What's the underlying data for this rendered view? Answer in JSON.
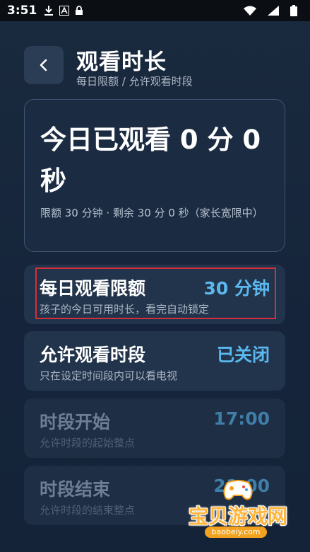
{
  "status_bar": {
    "time": "3:51"
  },
  "header": {
    "back_label": "<",
    "title": "观看时长",
    "subtitle": "每日限额 / 允许观看时段"
  },
  "summary": {
    "watched_today": "今日已观看 0 分 0 秒",
    "note": "限额 30 分钟 · 剩余 30 分 0 秒（家长宽限中）"
  },
  "settings": [
    {
      "title": "每日观看限额",
      "desc": "孩子的今日可用时长，看完自动锁定",
      "value": "30 分钟",
      "enabled": true
    },
    {
      "title": "允许观看时段",
      "desc": "只在设定时间段内可以看电视",
      "value": "已关闭",
      "enabled": true
    },
    {
      "title": "时段开始",
      "desc": "允许时段的起始整点",
      "value": "17:00",
      "enabled": false
    },
    {
      "title": "时段结束",
      "desc": "允许时段的结束整点",
      "value": "21:00",
      "enabled": false
    }
  ],
  "watermark": {
    "name": "宝贝游戏网",
    "url": "baobeiy.com"
  },
  "colors": {
    "accent": "#5bb8ee",
    "highlight_border": "#d42e3a",
    "background": "#15243a"
  }
}
